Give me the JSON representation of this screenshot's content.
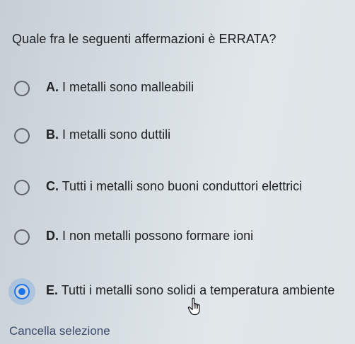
{
  "quiz": {
    "question": "Quale fra le seguenti affermazioni è ERRATA?",
    "selected_index": 4,
    "options": [
      {
        "letter": "A.",
        "text": "I metalli sono malleabili",
        "selected": false
      },
      {
        "letter": "B.",
        "text": "I metalli sono duttili",
        "selected": false
      },
      {
        "letter": "C.",
        "text": "Tutti i metalli sono buoni conduttori elettrici",
        "selected": false
      },
      {
        "letter": "D.",
        "text": "I non metalli possono formare ioni",
        "selected": false
      },
      {
        "letter": "E.",
        "text": "Tutti i metalli sono solidi a temperatura ambiente",
        "selected": true
      }
    ],
    "clear_label": "Cancella selezione"
  },
  "colors": {
    "accent": "#1a73e8",
    "text": "#202124",
    "radio_border": "#5f6368",
    "link": "#3a4a6b"
  },
  "icons": {
    "radio": "radio-button-icon",
    "cursor": "hand-pointer-icon"
  }
}
